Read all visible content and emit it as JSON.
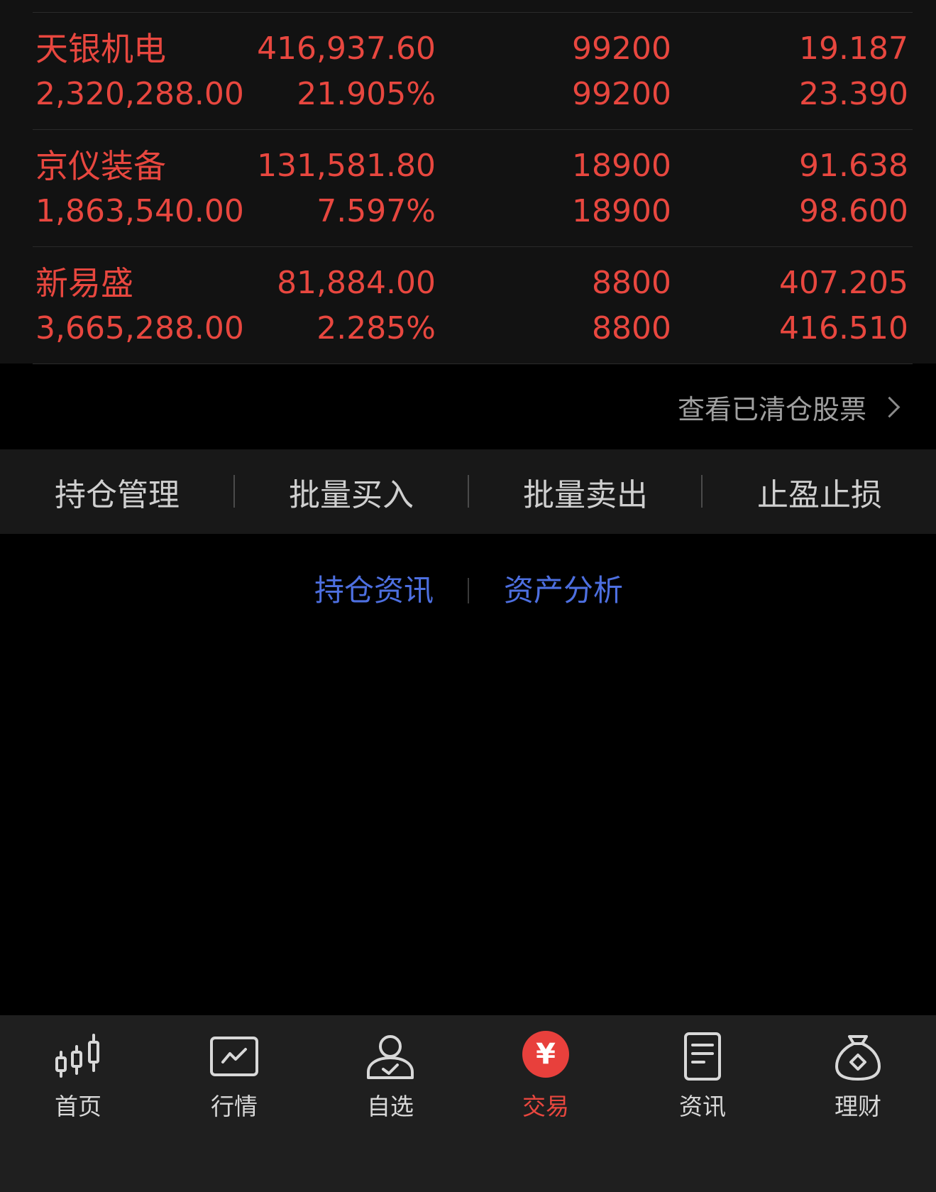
{
  "holdings": [
    {
      "name": "天银机电",
      "market_value": "2,320,288.00",
      "profit": "416,937.60",
      "profit_pct": "21.905%",
      "position": "99200",
      "available": "99200",
      "cost": "19.187",
      "price": "23.390"
    },
    {
      "name": "京仪装备",
      "market_value": "1,863,540.00",
      "profit": "131,581.80",
      "profit_pct": "7.597%",
      "position": "18900",
      "available": "18900",
      "cost": "91.638",
      "price": "98.600"
    },
    {
      "name": "新易盛",
      "market_value": "3,665,288.00",
      "profit": "81,884.00",
      "profit_pct": "2.285%",
      "position": "8800",
      "available": "8800",
      "cost": "407.205",
      "price": "416.510"
    }
  ],
  "cleared_link": "查看已清仓股票",
  "actions": [
    "持仓管理",
    "批量买入",
    "批量卖出",
    "止盈止损"
  ],
  "links": [
    "持仓资讯",
    "资产分析"
  ],
  "nav": [
    {
      "label": "首页",
      "icon": "candlestick-icon"
    },
    {
      "label": "行情",
      "icon": "market-chart-icon"
    },
    {
      "label": "自选",
      "icon": "user-check-icon"
    },
    {
      "label": "交易",
      "icon": "yen-icon",
      "active": true
    },
    {
      "label": "资讯",
      "icon": "document-icon"
    },
    {
      "label": "理财",
      "icon": "money-bag-icon"
    }
  ],
  "colors": {
    "up": "#e8473f",
    "link": "#4d6fe0",
    "background": "#000000",
    "panel": "#121212"
  }
}
